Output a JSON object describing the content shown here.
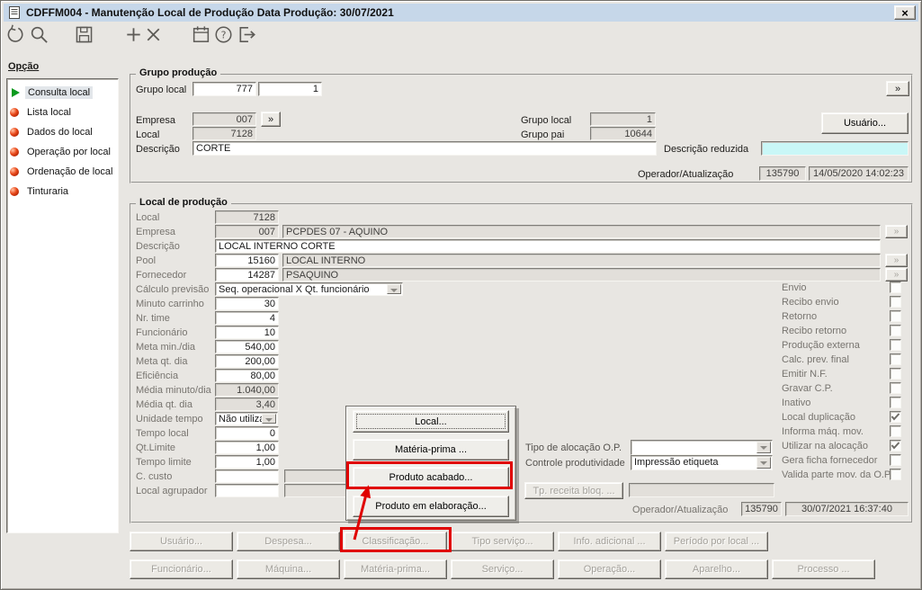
{
  "window": {
    "title": "CDFFM004 - Manutenção Local de Produção Data Produção: 30/07/2021",
    "close_glyph": "×"
  },
  "toolbar": {
    "icons": [
      "undo",
      "search",
      "save",
      "add",
      "delete",
      "calendar",
      "help",
      "exit"
    ]
  },
  "sidebar": {
    "heading": "Opção",
    "items": [
      {
        "label": "Consulta local",
        "icon": "play",
        "selected": true
      },
      {
        "label": "Lista local",
        "icon": "sphere",
        "selected": false
      },
      {
        "label": "Dados do local",
        "icon": "sphere",
        "selected": false
      },
      {
        "label": "Operação por local",
        "icon": "sphere",
        "selected": false
      },
      {
        "label": "Ordenação de local",
        "icon": "sphere",
        "selected": false
      },
      {
        "label": "Tinturaria",
        "icon": "sphere",
        "selected": false
      }
    ]
  },
  "grupo_producao": {
    "title": "Grupo produção",
    "nav": "»",
    "grupo_local": {
      "label": "Grupo local",
      "value1": "777",
      "value2": "1"
    },
    "empresa": {
      "label": "Empresa",
      "value": "007"
    },
    "local": {
      "label": "Local",
      "value": "7128"
    },
    "descricao": {
      "label": "Descrição",
      "value": "CORTE"
    },
    "grupo_local_dir": {
      "label": "Grupo local",
      "value": "1"
    },
    "grupo_pai": {
      "label": "Grupo pai",
      "value": "10644"
    },
    "usuario_button": "Usuário...",
    "descricao_reduzida": {
      "label": "Descrição reduzida",
      "value": ""
    },
    "operador": {
      "label": "Operador/Atualização",
      "code": "135790",
      "datetime": "14/05/2020 14:02:23"
    }
  },
  "local_producao": {
    "title": "Local de produção",
    "fields": [
      {
        "label": "Local",
        "value": "7128",
        "type": "ro",
        "align": "r"
      },
      {
        "label": "Empresa",
        "value": "007",
        "type": "ro",
        "align": "r",
        "wide": "PCPDES 07 - AQUINO",
        "nav": true
      },
      {
        "label": "Descrição",
        "value": "LOCAL INTERNO CORTE",
        "type": "editwide",
        "align": "l"
      },
      {
        "label": "Pool",
        "value": "15160",
        "type": "edit",
        "align": "r",
        "wide": "LOCAL INTERNO",
        "nav": true
      },
      {
        "label": "Fornecedor",
        "value": "14287",
        "type": "edit",
        "align": "r",
        "wide": "PSAQUINO",
        "nav": true
      },
      {
        "label": "Cálculo previsão",
        "value": "Seq. operacional X Qt. funcionário",
        "type": "combowide",
        "align": "l"
      },
      {
        "label": "Minuto carrinho",
        "value": "30",
        "type": "edit",
        "align": "r"
      },
      {
        "label": "Nr. time",
        "value": "4",
        "type": "edit",
        "align": "r"
      },
      {
        "label": "Funcionário",
        "value": "10",
        "type": "edit",
        "align": "r"
      },
      {
        "label": "Meta min./dia",
        "value": "540,00",
        "type": "edit",
        "align": "r"
      },
      {
        "label": "Meta qt. dia",
        "value": "200,00",
        "type": "edit",
        "align": "r"
      },
      {
        "label": "Eficiência",
        "value": "80,00",
        "type": "edit",
        "align": "r"
      },
      {
        "label": "Média minuto/dia",
        "value": "1.040,00",
        "type": "ro",
        "align": "r"
      },
      {
        "label": "Média qt. dia",
        "value": "3,40",
        "type": "ro",
        "align": "r"
      },
      {
        "label": "Unidade tempo",
        "value": "Não utiliza",
        "type": "combo",
        "align": "l"
      },
      {
        "label": "Tempo local",
        "value": "0",
        "type": "edit",
        "align": "r"
      },
      {
        "label": "Qt.Limite",
        "value": "1,00",
        "type": "edit",
        "align": "r"
      },
      {
        "label": "Tempo limite",
        "value": "1,00",
        "type": "edit",
        "align": "r"
      },
      {
        "label": "C. custo",
        "value": "",
        "type": "edit",
        "align": "l",
        "wideShort": true
      },
      {
        "label": "Local agrupador",
        "value": "",
        "type": "edit",
        "align": "l",
        "wideShort": true
      }
    ],
    "checkboxes": [
      {
        "label": "Envio",
        "checked": false
      },
      {
        "label": "Recibo envio",
        "checked": false
      },
      {
        "label": "Retorno",
        "checked": false
      },
      {
        "label": "Recibo retorno",
        "checked": false
      },
      {
        "label": "Produção externa",
        "checked": false
      },
      {
        "label": "Calc. prev. final",
        "checked": false
      },
      {
        "label": "Emitir N.F.",
        "checked": false
      },
      {
        "label": "Gravar C.P.",
        "checked": false
      },
      {
        "label": "Inativo",
        "checked": false
      },
      {
        "label": "Local duplicação",
        "checked": true
      },
      {
        "label": "Informa máq. mov.",
        "checked": false
      },
      {
        "label": "Utilizar na alocação",
        "checked": true
      },
      {
        "label": "Gera ficha fornecedor",
        "checked": false
      },
      {
        "label": "Valida parte mov. da O.P.",
        "checked": false
      }
    ],
    "tipo_alocacao": {
      "label": "Tipo de alocação O.P.",
      "value": ""
    },
    "controle_produtividade": {
      "label": "Controle produtividade",
      "value": "Impressão etiqueta"
    },
    "tp_receita_button": "Tp. receita bloq. ...",
    "operador": {
      "label": "Operador/Atualização",
      "code": "135790",
      "datetime": "30/07/2021 16:37:40"
    }
  },
  "popup_menu": {
    "items": [
      "Local...",
      "Matéria-prima ...",
      "Produto acabado...",
      "Produto em elaboração..."
    ],
    "highlighted": "Produto acabado..."
  },
  "action_buttons": {
    "row1": [
      "Usuário...",
      "Despesa...",
      "Classificação...",
      "Tipo serviço...",
      "Info. adicional ...",
      "Período por local ..."
    ],
    "row2": [
      "Funcionário...",
      "Máquina...",
      "Matéria-prima...",
      "Serviço...",
      "Operação...",
      "Aparelho...",
      "Processo ..."
    ],
    "highlighted": "Classificação..."
  },
  "annotation": {
    "highlight_color": "#e00000"
  }
}
